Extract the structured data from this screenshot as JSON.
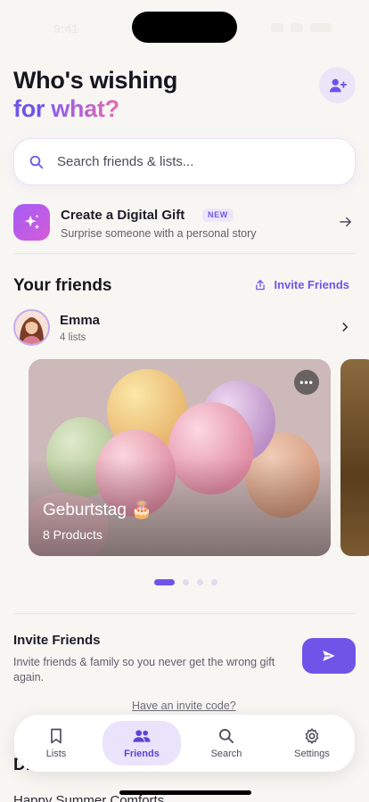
{
  "status_bar": {
    "time": "9:41"
  },
  "header": {
    "title_line1": "Who's wishing",
    "title_for": "for",
    "title_what": "what?",
    "add_friend_icon": "person-plus-icon"
  },
  "search": {
    "placeholder": "Search friends & lists...",
    "icon": "search-icon"
  },
  "digital_gift": {
    "title": "Create a Digital Gift",
    "badge": "NEW",
    "subtitle": "Surprise someone with a personal story",
    "icon": "sparkles-icon"
  },
  "friends_section": {
    "title": "Your friends",
    "invite_label": "Invite Friends",
    "friends": [
      {
        "name": "Emma",
        "count": "4 lists"
      }
    ]
  },
  "wishlist_cards": [
    {
      "title": "Geburtstag 🎂",
      "subtitle": "8 Products",
      "more_label": "•••"
    }
  ],
  "pagination": {
    "total": 4,
    "active_index": 0
  },
  "invite": {
    "title": "Invite Friends",
    "description": "Invite friends & family so you never get the wrong gift again.",
    "code_link": "Have an invite code?"
  },
  "behind_content": {
    "heading": "Di",
    "item": "Happy Summer Comforts"
  },
  "tab_bar": {
    "items": [
      {
        "label": "Lists",
        "icon": "bookmark-icon",
        "active": false
      },
      {
        "label": "Friends",
        "icon": "people-icon",
        "active": true
      },
      {
        "label": "Search",
        "icon": "search-icon",
        "active": false
      },
      {
        "label": "Settings",
        "icon": "gear-icon",
        "active": false
      }
    ]
  },
  "colors": {
    "accent": "#6e55e8",
    "background": "#f8f6f3",
    "active_tab_bg": "#e9e4fb"
  }
}
